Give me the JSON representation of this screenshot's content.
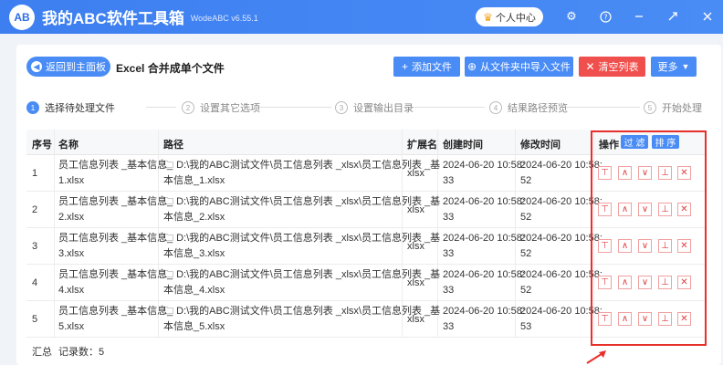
{
  "app": {
    "logo_text": "AB",
    "title": "我的ABC软件工具箱",
    "version": "WodeABC v6.55.1",
    "user_center": "个人中心"
  },
  "toolbar": {
    "back_label": "返回到主面板",
    "page_title": "Excel 合并成单个文件",
    "add_file": "添加文件",
    "import_folder": "从文件夹中导入文件",
    "clear_list": "清空列表",
    "more": "更多"
  },
  "steps": [
    {
      "num": "1",
      "label": "选择待处理文件"
    },
    {
      "num": "2",
      "label": "设置其它选项"
    },
    {
      "num": "3",
      "label": "设置输出目录"
    },
    {
      "num": "4",
      "label": "结果路径预览"
    },
    {
      "num": "5",
      "label": "开始处理"
    }
  ],
  "table": {
    "headers": {
      "index": "序号",
      "name": "名称",
      "path": "路径",
      "ext": "扩展名",
      "created": "创建时间",
      "modified": "修改时间",
      "ops": "操作",
      "filter": "过 滤",
      "sort": "排 序"
    },
    "rows": [
      {
        "index": "1",
        "name1": "员工信息列表 _基本信息_",
        "name2": "1.xlsx",
        "path1": "D:\\我的ABC测试文件\\员工信息列表 _xlsx\\员工信息列表 _基",
        "path2": "本信息_1.xlsx",
        "ext": "xlsx",
        "created1": "2024-06-20 10:58:",
        "created2": "33",
        "modified1": "2024-06-20 10:58:",
        "modified2": "52"
      },
      {
        "index": "2",
        "name1": "员工信息列表 _基本信息_",
        "name2": "2.xlsx",
        "path1": "D:\\我的ABC测试文件\\员工信息列表 _xlsx\\员工信息列表 _基",
        "path2": "本信息_2.xlsx",
        "ext": "xlsx",
        "created1": "2024-06-20 10:58:",
        "created2": "33",
        "modified1": "2024-06-20 10:58:",
        "modified2": "52"
      },
      {
        "index": "3",
        "name1": "员工信息列表 _基本信息_",
        "name2": "3.xlsx",
        "path1": "D:\\我的ABC测试文件\\员工信息列表 _xlsx\\员工信息列表 _基",
        "path2": "本信息_3.xlsx",
        "ext": "xlsx",
        "created1": "2024-06-20 10:58:",
        "created2": "33",
        "modified1": "2024-06-20 10:58:",
        "modified2": "52"
      },
      {
        "index": "4",
        "name1": "员工信息列表 _基本信息_",
        "name2": "4.xlsx",
        "path1": "D:\\我的ABC测试文件\\员工信息列表 _xlsx\\员工信息列表 _基",
        "path2": "本信息_4.xlsx",
        "ext": "xlsx",
        "created1": "2024-06-20 10:58:",
        "created2": "33",
        "modified1": "2024-06-20 10:58:",
        "modified2": "52"
      },
      {
        "index": "5",
        "name1": "员工信息列表 _基本信息_",
        "name2": "5.xlsx",
        "path1": "D:\\我的ABC测试文件\\员工信息列表 _xlsx\\员工信息列表 _基",
        "path2": "本信息_5.xlsx",
        "ext": "xlsx",
        "created1": "2024-06-20 10:58:",
        "created2": "33",
        "modified1": "2024-06-20 10:58:",
        "modified2": "53"
      }
    ],
    "row_ops": [
      "move-top-icon",
      "move-up-icon",
      "move-down-icon",
      "move-bottom-icon",
      "delete-icon"
    ]
  },
  "summary": {
    "label": "汇总",
    "count": "记录数：5"
  },
  "colors": {
    "primary": "#4a8cf5",
    "danger": "#f0504d",
    "highlight": "#e8302b"
  }
}
